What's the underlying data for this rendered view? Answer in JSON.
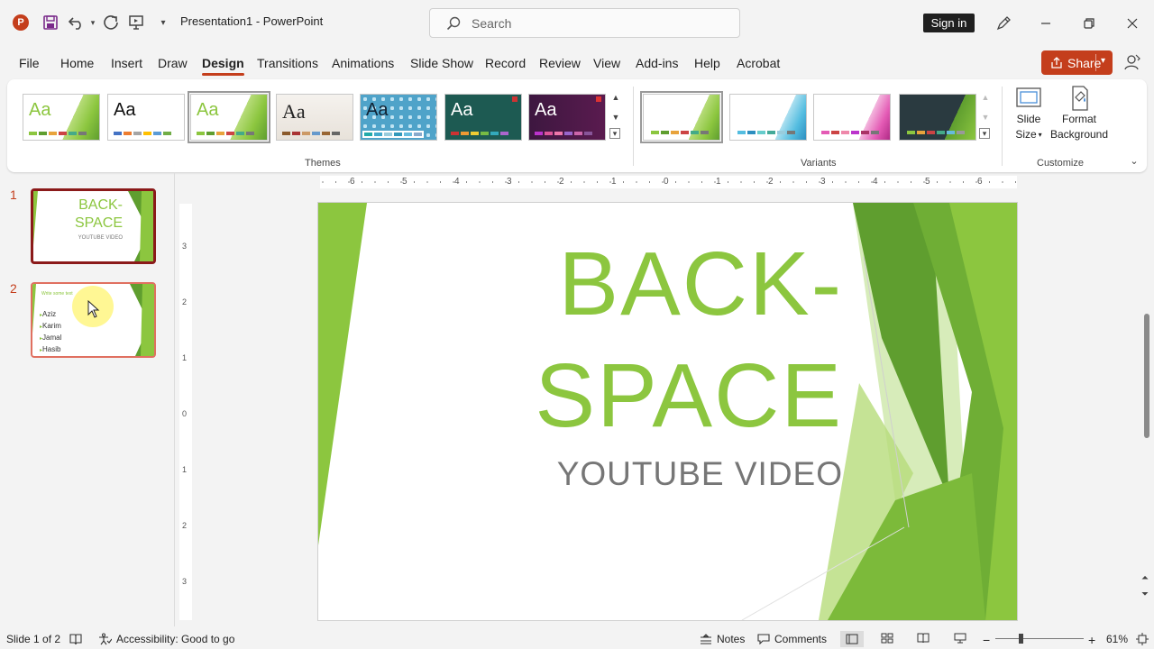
{
  "app": {
    "logo_letter": "P",
    "doc_title": "Presentation1  -  PowerPoint",
    "search_placeholder": "Search",
    "signin_label": "Sign in"
  },
  "menu": {
    "tabs": [
      "File",
      "Home",
      "Insert",
      "Draw",
      "Design",
      "Transitions",
      "Animations",
      "Slide Show",
      "Record",
      "Review",
      "View",
      "Add-ins",
      "Help",
      "Acrobat"
    ],
    "active_tab": "Design",
    "share_label": "Share"
  },
  "ribbon": {
    "themes_label": "Themes",
    "variants_label": "Variants",
    "customize_label": "Customize",
    "theme_sample_text": "Aa",
    "slide_size_label": "Slide",
    "slide_size_label2": "Size",
    "format_bg_label": "Format",
    "format_bg_label2": "Background"
  },
  "thumbnails": [
    {
      "number": "1",
      "title_line1": "BACK-",
      "title_line2": "SPACE",
      "subtitle": "YOUTUBE VIDEO"
    },
    {
      "number": "2",
      "heading": "Write some text",
      "bullets": [
        "Aziz",
        "Karim",
        "Jamal",
        "Hasib"
      ]
    }
  ],
  "slide": {
    "title_line1": "BACK-",
    "title_line2": "SPACE",
    "subtitle": "YOUTUBE VIDEO"
  },
  "rulers": {
    "horizontal_ticks": [
      "6",
      "5",
      "4",
      "3",
      "2",
      "1",
      "0",
      "1",
      "2",
      "3",
      "4",
      "5",
      "6"
    ],
    "vertical_ticks": [
      "3",
      "2",
      "1",
      "0",
      "1",
      "2",
      "3"
    ]
  },
  "status": {
    "slide_position": "Slide 1 of 2",
    "accessibility": "Accessibility: Good to go",
    "notes_label": "Notes",
    "comments_label": "Comments",
    "zoom": "61%"
  },
  "colors": {
    "accent": "#c43e1c",
    "slide_green": "#8cc63f"
  }
}
